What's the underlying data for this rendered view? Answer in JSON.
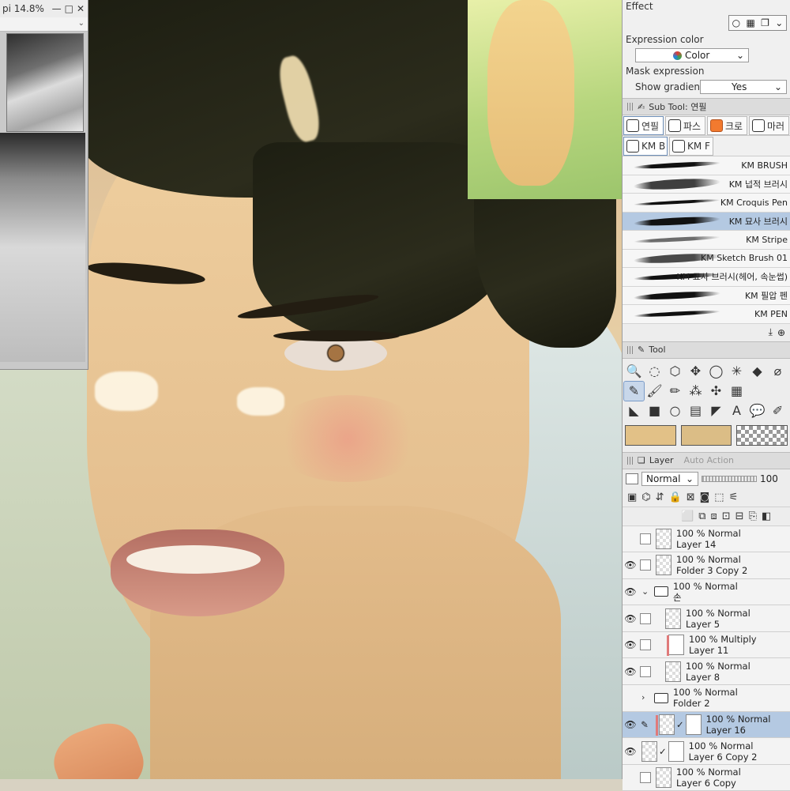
{
  "navigator": {
    "title": "pi 14.8%",
    "btn_min": "—",
    "btn_max": "□",
    "btn_close": "✕"
  },
  "effect": {
    "header": "Effect",
    "expression_color_label": "Expression color",
    "expression_color_value": "Color",
    "mask_expression_label": "Mask expression",
    "show_gradients_label": "Show gradients",
    "show_gradients_value": "Yes"
  },
  "subtool": {
    "header": "Sub Tool: 연필",
    "tabs_row1": [
      "연필",
      "파스",
      "크로",
      "마러"
    ],
    "tabs_row2": [
      "KM B",
      "KM F"
    ],
    "brushes": [
      {
        "name": "KM BRUSH"
      },
      {
        "name": "KM 넙적 브러시"
      },
      {
        "name": "KM Croquis Pen"
      },
      {
        "name": "KM 묘사 브러시"
      },
      {
        "name": "KM Stripe"
      },
      {
        "name": "KM Sketch Brush 01"
      },
      {
        "name": "KM 묘사 브러시(헤어, 속눈썹)"
      },
      {
        "name": "KM 필압 펜"
      },
      {
        "name": "KM PEN"
      }
    ],
    "selected_brush_index": 3
  },
  "tool": {
    "header": "Tool",
    "icons": [
      "magnifier-icon",
      "lasso-select-icon",
      "cube-icon",
      "move-icon",
      "lasso-icon",
      "sparkle-icon",
      "eraser-icon",
      "eyedropper-icon",
      "pen-icon",
      "brush-icon",
      "pencil-icon",
      "spray-icon",
      "blend-icon",
      "grid-icon",
      "fill-icon",
      "gradient-icon",
      "ellipse-icon",
      "frame-icon",
      "ruler-icon",
      "text-icon",
      "balloon-icon",
      "correction-icon"
    ],
    "glyphs": [
      "🔍",
      "◌",
      "⬡",
      "✥",
      "◯",
      "✳",
      "◆",
      "⌀",
      "✎",
      "🖌",
      "✏",
      "⁂",
      "✣",
      "▦",
      "◣",
      "■",
      "○",
      "▤",
      "◤",
      "A",
      "💬",
      "✐"
    ],
    "main_color": "#e2c187",
    "sub_color": "#dbbd86"
  },
  "layer_panel": {
    "tab_layer": "Layer",
    "tab_auto_action": "Auto Action",
    "blend_mode": "Normal",
    "opacity": "100",
    "layers": [
      {
        "opacity_mode": "100 % Normal",
        "name": "Layer 14",
        "visible": false,
        "type": "layer"
      },
      {
        "opacity_mode": "100 % Normal",
        "name": "Folder 3 Copy 2",
        "visible": true,
        "type": "layer"
      },
      {
        "opacity_mode": "100 % Normal",
        "name": "손",
        "visible": true,
        "type": "folder-open"
      },
      {
        "opacity_mode": "100 % Normal",
        "name": "Layer 5",
        "visible": true,
        "type": "layer"
      },
      {
        "opacity_mode": "100 % Multiply",
        "name": "Layer 11",
        "visible": true,
        "type": "layer"
      },
      {
        "opacity_mode": "100 % Normal",
        "name": "Layer 8",
        "visible": true,
        "type": "layer"
      },
      {
        "opacity_mode": "100 % Normal",
        "name": "Folder 2",
        "visible": false,
        "type": "folder-closed"
      },
      {
        "opacity_mode": "100 % Normal",
        "name": "Layer 16",
        "visible": true,
        "type": "layer",
        "selected": true
      },
      {
        "opacity_mode": "100 % Normal",
        "name": "Layer 6 Copy 2",
        "visible": true,
        "type": "layer"
      },
      {
        "opacity_mode": "100 % Normal",
        "name": "Layer 6 Copy",
        "visible": false,
        "type": "layer"
      }
    ]
  }
}
